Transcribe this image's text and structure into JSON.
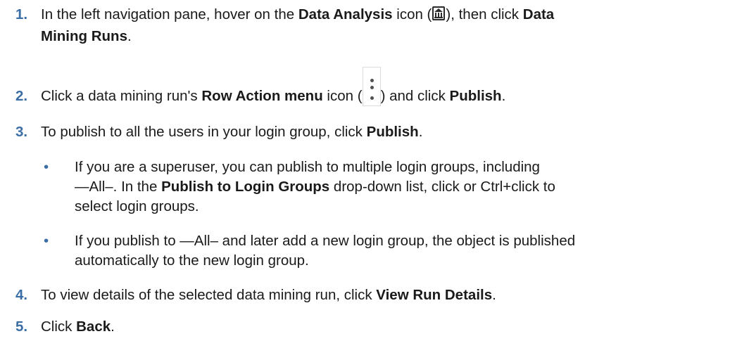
{
  "steps": [
    {
      "number": "1.",
      "t1": "In the left navigation pane, hover on the ",
      "b1": "Data Analysis",
      "t2": " icon (",
      "t3": "), then click ",
      "b2": "Data",
      "b3": "Mining Runs",
      "t4": ".",
      "icon": "data-analysis-icon"
    },
    {
      "number": "2.",
      "t1": "Click a data mining run's ",
      "b1": "Row Action menu",
      "t2": " icon (",
      "t3": ") and click ",
      "b2": "Publish",
      "t4": ".",
      "icon": "row-action-menu-icon"
    },
    {
      "number": "3.",
      "t1": "To publish to all the users in your login group, click ",
      "b1": "Publish",
      "t2": ".",
      "bullets": [
        {
          "marker": "•",
          "line1": "If you are a superuser, you can publish to multiple login groups, including",
          "line2a": "—All–. In the ",
          "bold": "Publish to Login Groups",
          "line2b": " drop-down list, click or Ctrl+click to",
          "line3": "select login groups."
        },
        {
          "marker": "•",
          "line1": "If you publish to —All– and later add a new login group, the object is published",
          "line2": "automatically to the new login group."
        }
      ]
    },
    {
      "number": "4.",
      "t1": "To view details of the selected data mining run, click ",
      "b1": "View Run Details",
      "t2": "."
    },
    {
      "number": "5.",
      "t1": "Click ",
      "b1": "Back",
      "t2": "."
    }
  ]
}
